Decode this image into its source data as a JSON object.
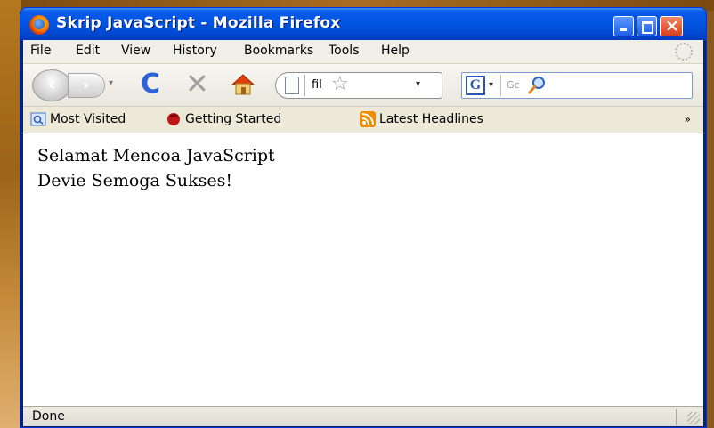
{
  "window": {
    "title": "Skrip JavaScript - Mozilla Firefox"
  },
  "menu": {
    "items": [
      {
        "label": "File"
      },
      {
        "label": "Edit"
      },
      {
        "label": "View"
      },
      {
        "label": "History"
      },
      {
        "label": "Bookmarks"
      },
      {
        "label": "Tools"
      },
      {
        "label": "Help"
      }
    ]
  },
  "nav": {
    "back_glyph": "‹",
    "forward_glyph": "›",
    "dropdown_glyph": "▾",
    "reload_glyph": "C",
    "stop_glyph": "✕",
    "url_text": "fil",
    "star_glyph": "☆",
    "search_engine_label": "G",
    "search_placeholder": "Gc"
  },
  "bookmarks": {
    "items": [
      {
        "label": "Most Visited",
        "icon": "most-visited-icon"
      },
      {
        "label": "Getting Started",
        "icon": "firefox-icon"
      },
      {
        "label": "Latest Headlines",
        "icon": "rss-icon"
      }
    ],
    "overflow": "»"
  },
  "content": {
    "lines": [
      "Selamat Mencoa JavaScript",
      "Devie Semoga Sukses!"
    ]
  },
  "status": {
    "text": "Done"
  },
  "colors": {
    "titlebar": "#0054e3",
    "close_button": "#d6401c",
    "rss": "#f08c00"
  }
}
